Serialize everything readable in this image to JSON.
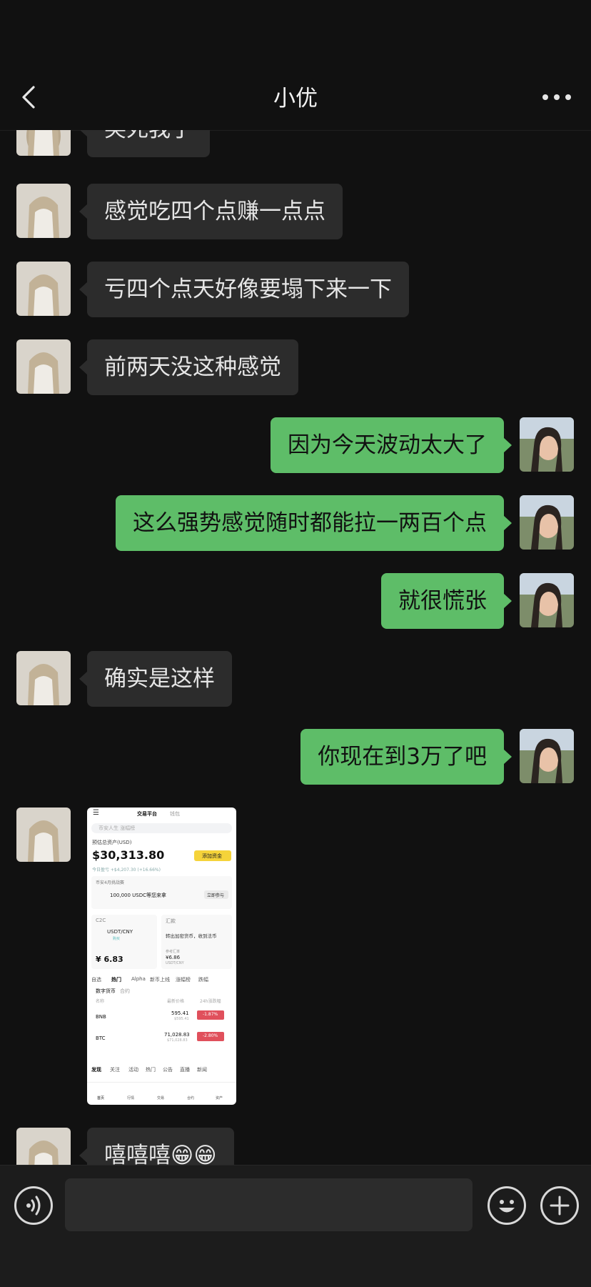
{
  "header": {
    "title": "小优"
  },
  "messages": [
    {
      "side": "in",
      "text": "笑死我了"
    },
    {
      "side": "in",
      "text": "感觉吃四个点赚一点点"
    },
    {
      "side": "in",
      "text": "亏四个点天好像要塌下来一下"
    },
    {
      "side": "in",
      "text": "前两天没这种感觉"
    },
    {
      "side": "out",
      "text": "因为今天波动太大了"
    },
    {
      "side": "out",
      "text": "这么强势感觉随时都能拉一两百个点"
    },
    {
      "side": "out",
      "text": "就很慌张"
    },
    {
      "side": "in",
      "text": "确实是这样"
    },
    {
      "side": "out",
      "text": "你现在到3万了吧"
    },
    {
      "side": "in",
      "text": "嘻嘻嘻😁😁"
    }
  ],
  "screenshot": {
    "tab_trade": "交易平台",
    "tab_wallet": "钱包",
    "search_placeholder": "币安人生 涨幅榜",
    "asset_label": "预估总资产(USD)",
    "balance": "$30,313.80",
    "add_funds": "添加资金",
    "pnl": "今日盈亏 +$4,207.30 (+16.66%)",
    "promo_title": "币安4月挑战赛",
    "promo_text": "100,000 USDC等您来拿",
    "promo_button": "立即参与",
    "c2c_label": "C2C",
    "c2c_pair": "USDT/CNY",
    "c2c_sub": "购买",
    "c2c_price": "¥ 6.83",
    "remit_label": "汇款",
    "remit_text": "转出加密货币，收到法币",
    "remit_rate_label": "参考汇率",
    "remit_rate": "¥6.86",
    "remit_pair": "USDT/CNY",
    "market_tabs": [
      "自选",
      "热门",
      "Alpha",
      "新币上线",
      "涨幅榜",
      "跌幅"
    ],
    "sub_tabs": [
      "数字货币",
      "合约"
    ],
    "col_name": "名称",
    "col_price": "最新价格",
    "col_change": "24h涨跌幅",
    "coins": [
      {
        "name": "BNB",
        "price": "595.41",
        "sub": "$595.41",
        "change": "-1.87%"
      },
      {
        "name": "BTC",
        "price": "71,028.83",
        "sub": "$71,028.83",
        "change": "-2.80%"
      }
    ],
    "feed_tabs": [
      "发现",
      "关注",
      "活动",
      "热门",
      "公告",
      "直播",
      "新闻"
    ],
    "nav_items": [
      "首页",
      "行情",
      "交易",
      "合约",
      "资产"
    ]
  },
  "colors": {
    "outgoing": "#5ebd68",
    "incoming": "#2c2c2c",
    "background": "#111111"
  },
  "icons": [
    "back-icon",
    "more-icon",
    "voice-icon",
    "emoji-icon",
    "plus-icon"
  ]
}
